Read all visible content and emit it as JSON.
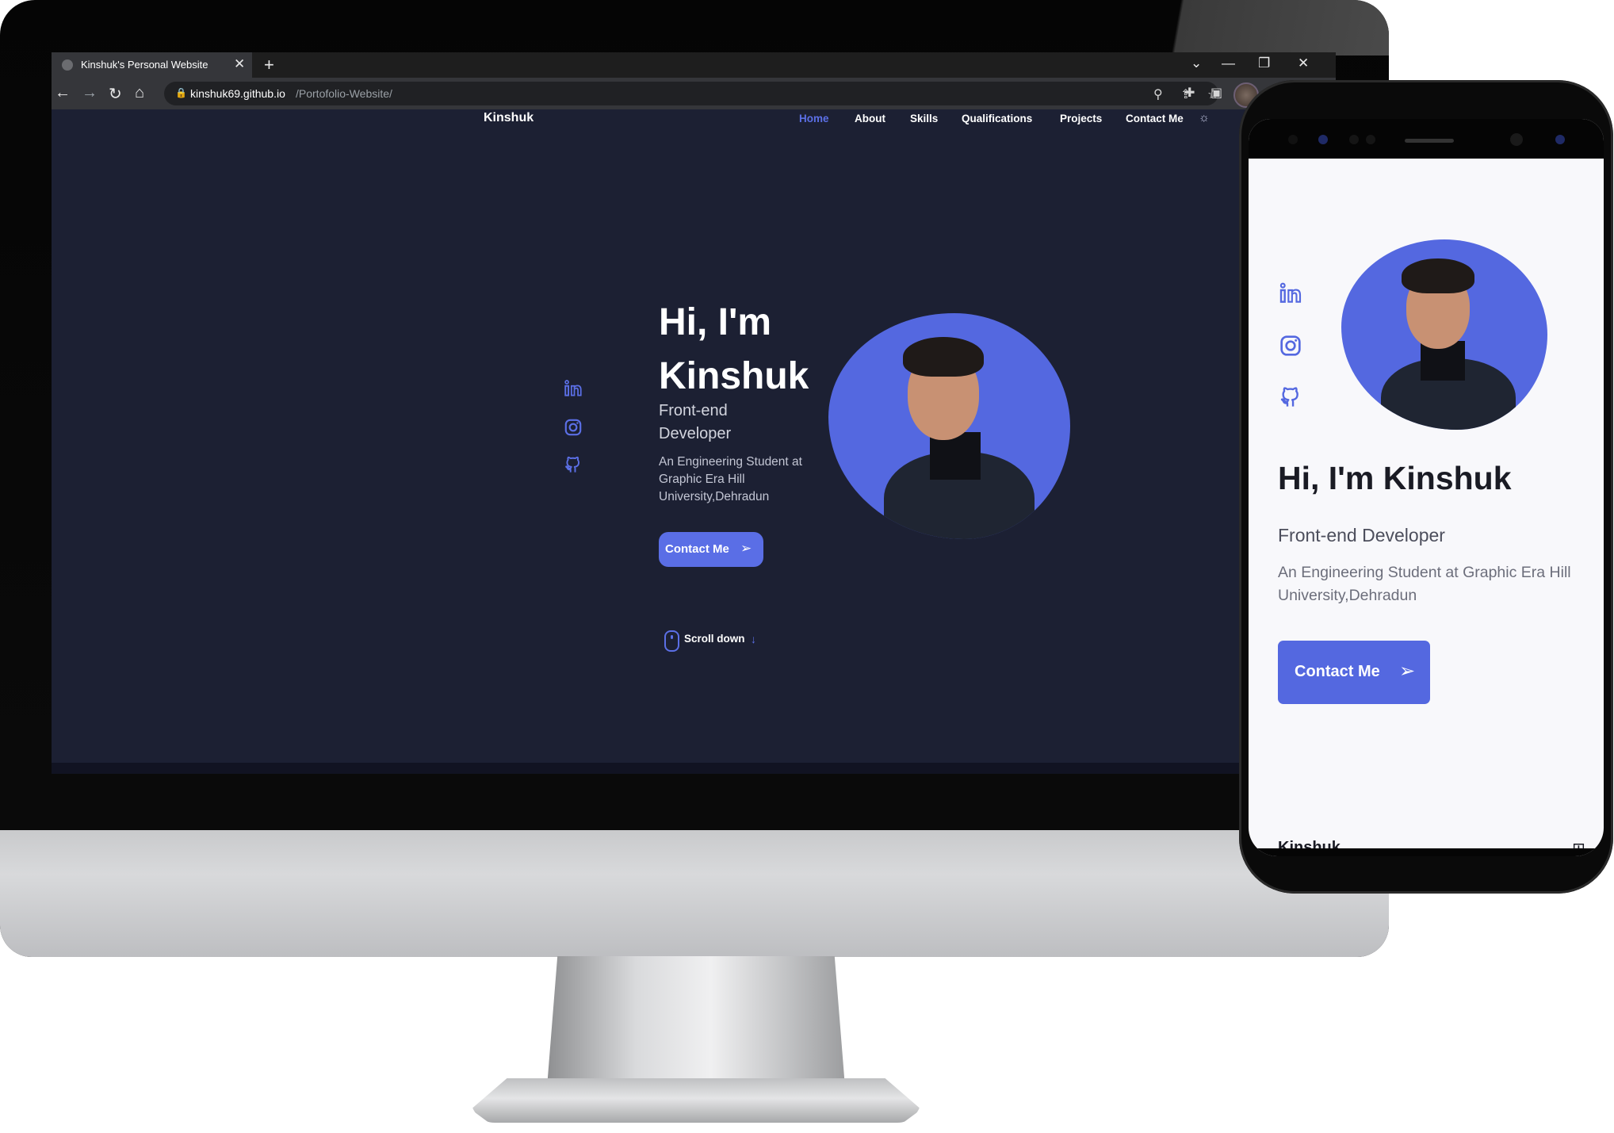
{
  "browser": {
    "tab_title": "Kinshuk's Personal Website",
    "tab_close": "✕",
    "new_tab": "+",
    "url_host": "kinshuk69.github.io",
    "url_path": "/Portofolio-Website/",
    "window_controls": [
      "⌄",
      "—",
      "❐",
      "✕"
    ]
  },
  "site": {
    "logo": "Kinshuk",
    "nav": [
      "Home",
      "About",
      "Skills",
      "Qualifications",
      "Projects",
      "Contact Me"
    ],
    "active_nav": "Home",
    "hero_title": "Hi, I'm Kinshuk",
    "hero_subtitle": "Front-end Developer",
    "hero_description": "An Engineering Student at Graphic Era Hill University,Dehradun",
    "contact_button": "Contact Me",
    "scroll_text": "Scroll down",
    "social_icons": [
      "linkedin-icon",
      "instagram-icon",
      "github-icon"
    ]
  },
  "mobile": {
    "hero_title": "Hi, I'm Kinshuk",
    "hero_subtitle": "Front-end Developer",
    "hero_description": "An Engineering Student at Graphic Era Hill University,Dehradun",
    "contact_button": "Contact Me",
    "logo": "Kinshuk"
  },
  "colors": {
    "accent": "#5b6fe6",
    "desktop_bg": "#1c2033",
    "mobile_bg": "#f8f8fb"
  }
}
